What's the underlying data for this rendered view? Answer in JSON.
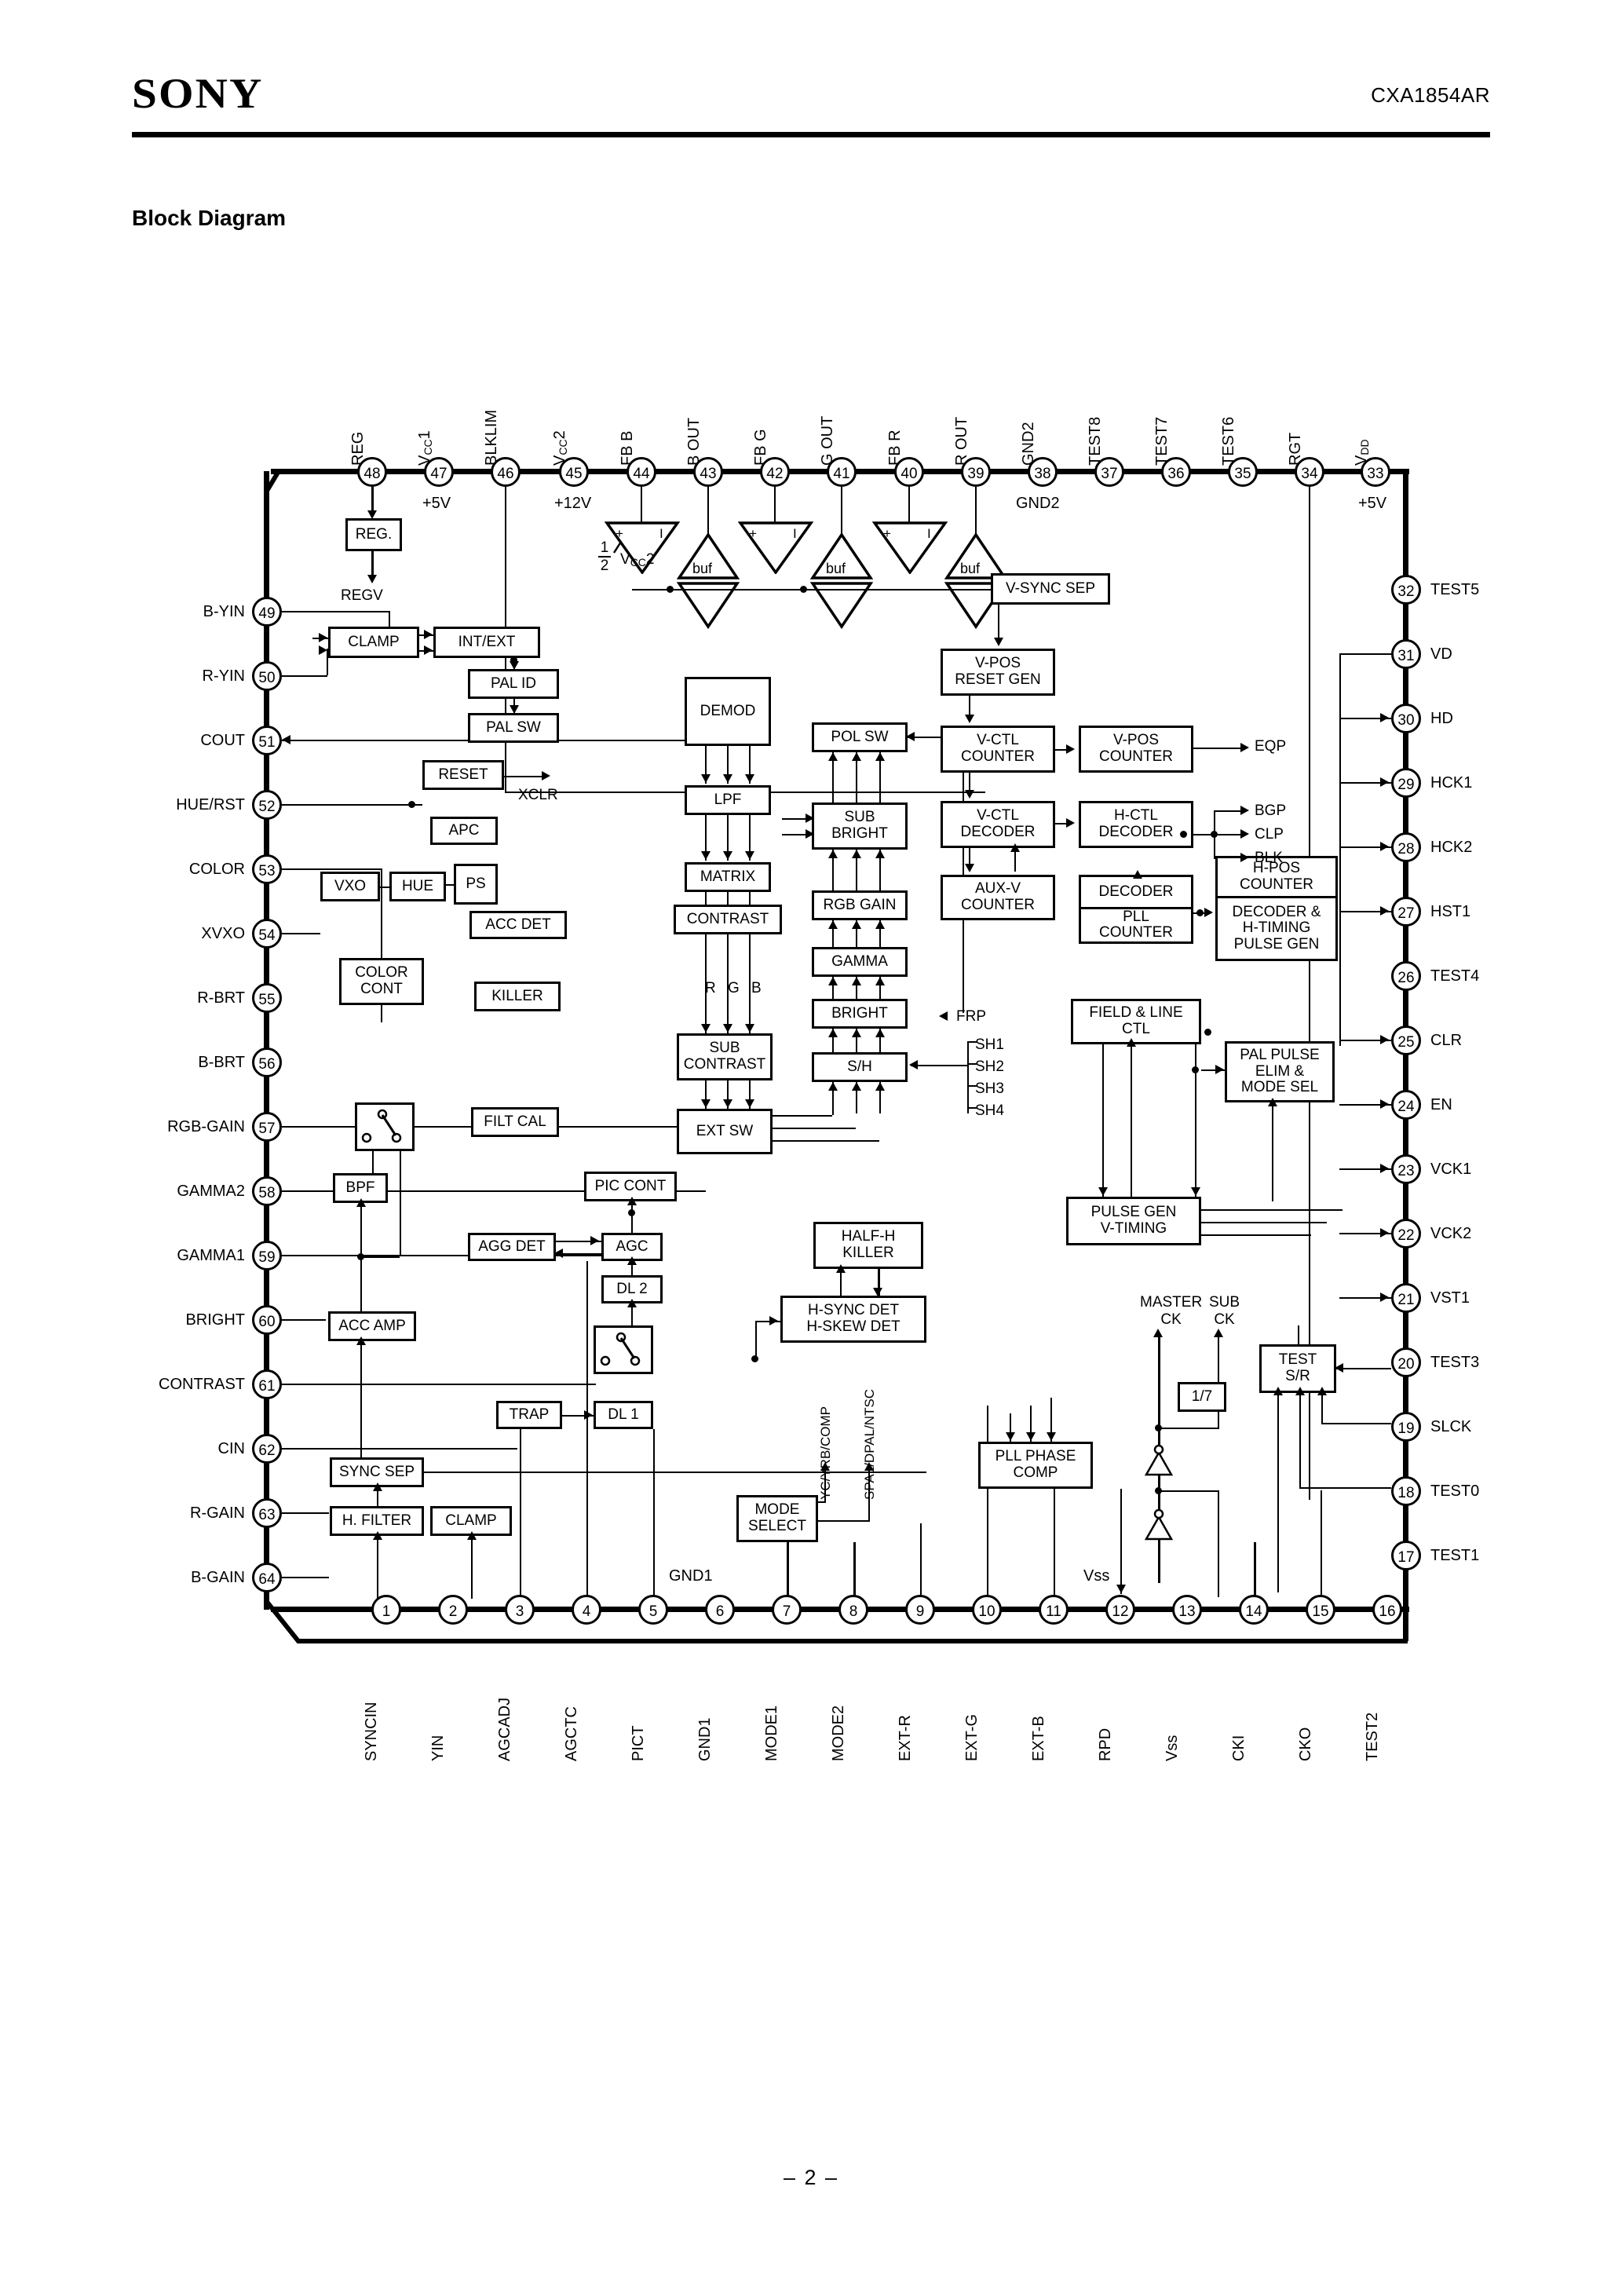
{
  "header": {
    "brand": "SONY",
    "part_number": "CXA1854AR",
    "section_title": "Block Diagram",
    "page_footer": "– 2 –"
  },
  "pins": {
    "top": [
      {
        "num": "48",
        "name": "REG",
        "note": ""
      },
      {
        "num": "47",
        "name": "Vcc1",
        "note": "+5V"
      },
      {
        "num": "46",
        "name": "BLKLIM",
        "note": ""
      },
      {
        "num": "45",
        "name": "Vcc2",
        "note": "+12V"
      },
      {
        "num": "44",
        "name": "FB B",
        "note": ""
      },
      {
        "num": "43",
        "name": "B OUT",
        "note": ""
      },
      {
        "num": "42",
        "name": "FB G",
        "note": ""
      },
      {
        "num": "41",
        "name": "G OUT",
        "note": ""
      },
      {
        "num": "40",
        "name": "FB R",
        "note": ""
      },
      {
        "num": "39",
        "name": "R OUT",
        "note": ""
      },
      {
        "num": "38",
        "name": "GND2",
        "note": "GND2"
      },
      {
        "num": "37",
        "name": "TEST8",
        "note": ""
      },
      {
        "num": "36",
        "name": "TEST7",
        "note": ""
      },
      {
        "num": "35",
        "name": "TEST6",
        "note": ""
      },
      {
        "num": "34",
        "name": "RGT",
        "note": ""
      },
      {
        "num": "33",
        "name": "VDD",
        "note": "+5V"
      }
    ],
    "left": [
      {
        "num": "49",
        "name": "B-YIN"
      },
      {
        "num": "50",
        "name": "R-YIN"
      },
      {
        "num": "51",
        "name": "COUT"
      },
      {
        "num": "52",
        "name": "HUE/RST"
      },
      {
        "num": "53",
        "name": "COLOR"
      },
      {
        "num": "54",
        "name": "XVXO"
      },
      {
        "num": "55",
        "name": "R-BRT"
      },
      {
        "num": "56",
        "name": "B-BRT"
      },
      {
        "num": "57",
        "name": "RGB-GAIN"
      },
      {
        "num": "58",
        "name": "GAMMA2"
      },
      {
        "num": "59",
        "name": "GAMMA1"
      },
      {
        "num": "60",
        "name": "BRIGHT"
      },
      {
        "num": "61",
        "name": "CONTRAST"
      },
      {
        "num": "62",
        "name": "CIN"
      },
      {
        "num": "63",
        "name": "R-GAIN"
      },
      {
        "num": "64",
        "name": "B-GAIN"
      }
    ],
    "right": [
      {
        "num": "32",
        "name": "TEST5"
      },
      {
        "num": "31",
        "name": "VD"
      },
      {
        "num": "30",
        "name": "HD"
      },
      {
        "num": "29",
        "name": "HCK1"
      },
      {
        "num": "28",
        "name": "HCK2"
      },
      {
        "num": "27",
        "name": "HST1"
      },
      {
        "num": "26",
        "name": "TEST4"
      },
      {
        "num": "25",
        "name": "CLR"
      },
      {
        "num": "24",
        "name": "EN"
      },
      {
        "num": "23",
        "name": "VCK1"
      },
      {
        "num": "22",
        "name": "VCK2"
      },
      {
        "num": "21",
        "name": "VST1"
      },
      {
        "num": "20",
        "name": "TEST3"
      },
      {
        "num": "19",
        "name": "SLCK"
      },
      {
        "num": "18",
        "name": "TEST0"
      },
      {
        "num": "17",
        "name": "TEST1"
      }
    ],
    "bottom": [
      {
        "num": "1",
        "name": "SYNCIN",
        "note": ""
      },
      {
        "num": "2",
        "name": "YIN",
        "note": ""
      },
      {
        "num": "3",
        "name": "AGCADJ",
        "note": ""
      },
      {
        "num": "4",
        "name": "AGCTC",
        "note": ""
      },
      {
        "num": "5",
        "name": "PICT",
        "note": ""
      },
      {
        "num": "6",
        "name": "GND1",
        "note": "GND1"
      },
      {
        "num": "7",
        "name": "MODE1",
        "note": ""
      },
      {
        "num": "8",
        "name": "MODE2",
        "note": ""
      },
      {
        "num": "9",
        "name": "EXT-R",
        "note": ""
      },
      {
        "num": "10",
        "name": "EXT-G",
        "note": ""
      },
      {
        "num": "11",
        "name": "EXT-B",
        "note": ""
      },
      {
        "num": "12",
        "name": "RPD",
        "note": ""
      },
      {
        "num": "13",
        "name": "Vss",
        "note": "Vss"
      },
      {
        "num": "14",
        "name": "CKI",
        "note": ""
      },
      {
        "num": "15",
        "name": "CKO",
        "note": ""
      },
      {
        "num": "16",
        "name": "TEST2",
        "note": ""
      }
    ]
  },
  "blocks": {
    "reg": "REG.",
    "clamp_top": "CLAMP",
    "int_ext": "INT/EXT",
    "pal_id": "PAL ID",
    "pal_sw": "PAL SW",
    "demod": "DEMOD",
    "reset": "RESET",
    "lpf": "LPF",
    "apc": "APC",
    "vxo": "VXO",
    "hue": "HUE",
    "ps": "PS",
    "matrix": "MATRIX",
    "acc_det": "ACC DET",
    "contrast": "CONTRAST",
    "color_cont": "COLOR\nCONT",
    "killer": "KILLER",
    "pol_sw": "POL SW",
    "sub_bright": "SUB\nBRIGHT",
    "rgb_gain": "RGB GAIN",
    "gamma": "GAMMA",
    "bright": "BRIGHT",
    "sh": "S/H",
    "sub_contrast": "SUB\nCONTRAST",
    "ext_sw": "EXT SW",
    "filt_cal": "FILT CAL",
    "pic_cont": "PIC CONT",
    "bpf": "BPF",
    "agg_det": "AGG DET",
    "agc": "AGC",
    "dl2": "DL 2",
    "dl1": "DL 1",
    "trap": "TRAP",
    "acc_amp": "ACC AMP",
    "sync_sep": "SYNC SEP",
    "h_filter": "H. FILTER",
    "clamp_bottom": "CLAMP",
    "mode_select": "MODE\nSELECT",
    "half_h_killer": "HALF-H\nKILLER",
    "h_sync_det": "H-SYNC DET\nH-SKEW DET",
    "pll_phase_comp": "PLL PHASE\nCOMP",
    "v_sync_sep": "V-SYNC SEP",
    "v_pos_reset_gen": "V-POS\nRESET GEN",
    "v_ctl_counter": "V-CTL\nCOUNTER",
    "v_pos_counter": "V-POS\nCOUNTER",
    "v_ctl_decoder": "V-CTL\nDECODER",
    "h_ctl_decoder": "H-CTL\nDECODER",
    "aux_v_counter": "AUX-V\nCOUNTER",
    "decoder": "DECODER",
    "pll_counter": "PLL\nCOUNTER",
    "h_pos_counter": "H-POS\nCOUNTER",
    "decoder_h_timing": "DECODER &\nH-TIMING\nPULSE GEN",
    "field_line_ctl": "FIELD & LINE\nCTL",
    "pal_pulse_elim": "PAL PULSE\nELIM &\nMODE SEL",
    "pulse_gen_v": "PULSE GEN\nV-TIMING",
    "test_sr": "TEST\nS/R",
    "divider": "1/7",
    "buf": "buf"
  },
  "signals": {
    "regv": "REGV",
    "xclr": "XCLR",
    "rgb": "R G B",
    "eqp": "EQP",
    "bgp": "BGP",
    "clp": "CLP",
    "blk": "BLK",
    "frp": "FRP",
    "sh1": "SH1",
    "sh2": "SH2",
    "sh3": "SH3",
    "sh4": "SH4",
    "master_ck": "MASTER\nCK",
    "sub_ck": "SUB\nCK",
    "half_vcc2_num": "1",
    "half_vcc2_den": "2",
    "half_vcc2_label": "Vcc2",
    "yc_yrb_comp": "YC/YRB/COMP",
    "spal_dpal_ntsc": "SPAL/DPAL/NTSC"
  }
}
